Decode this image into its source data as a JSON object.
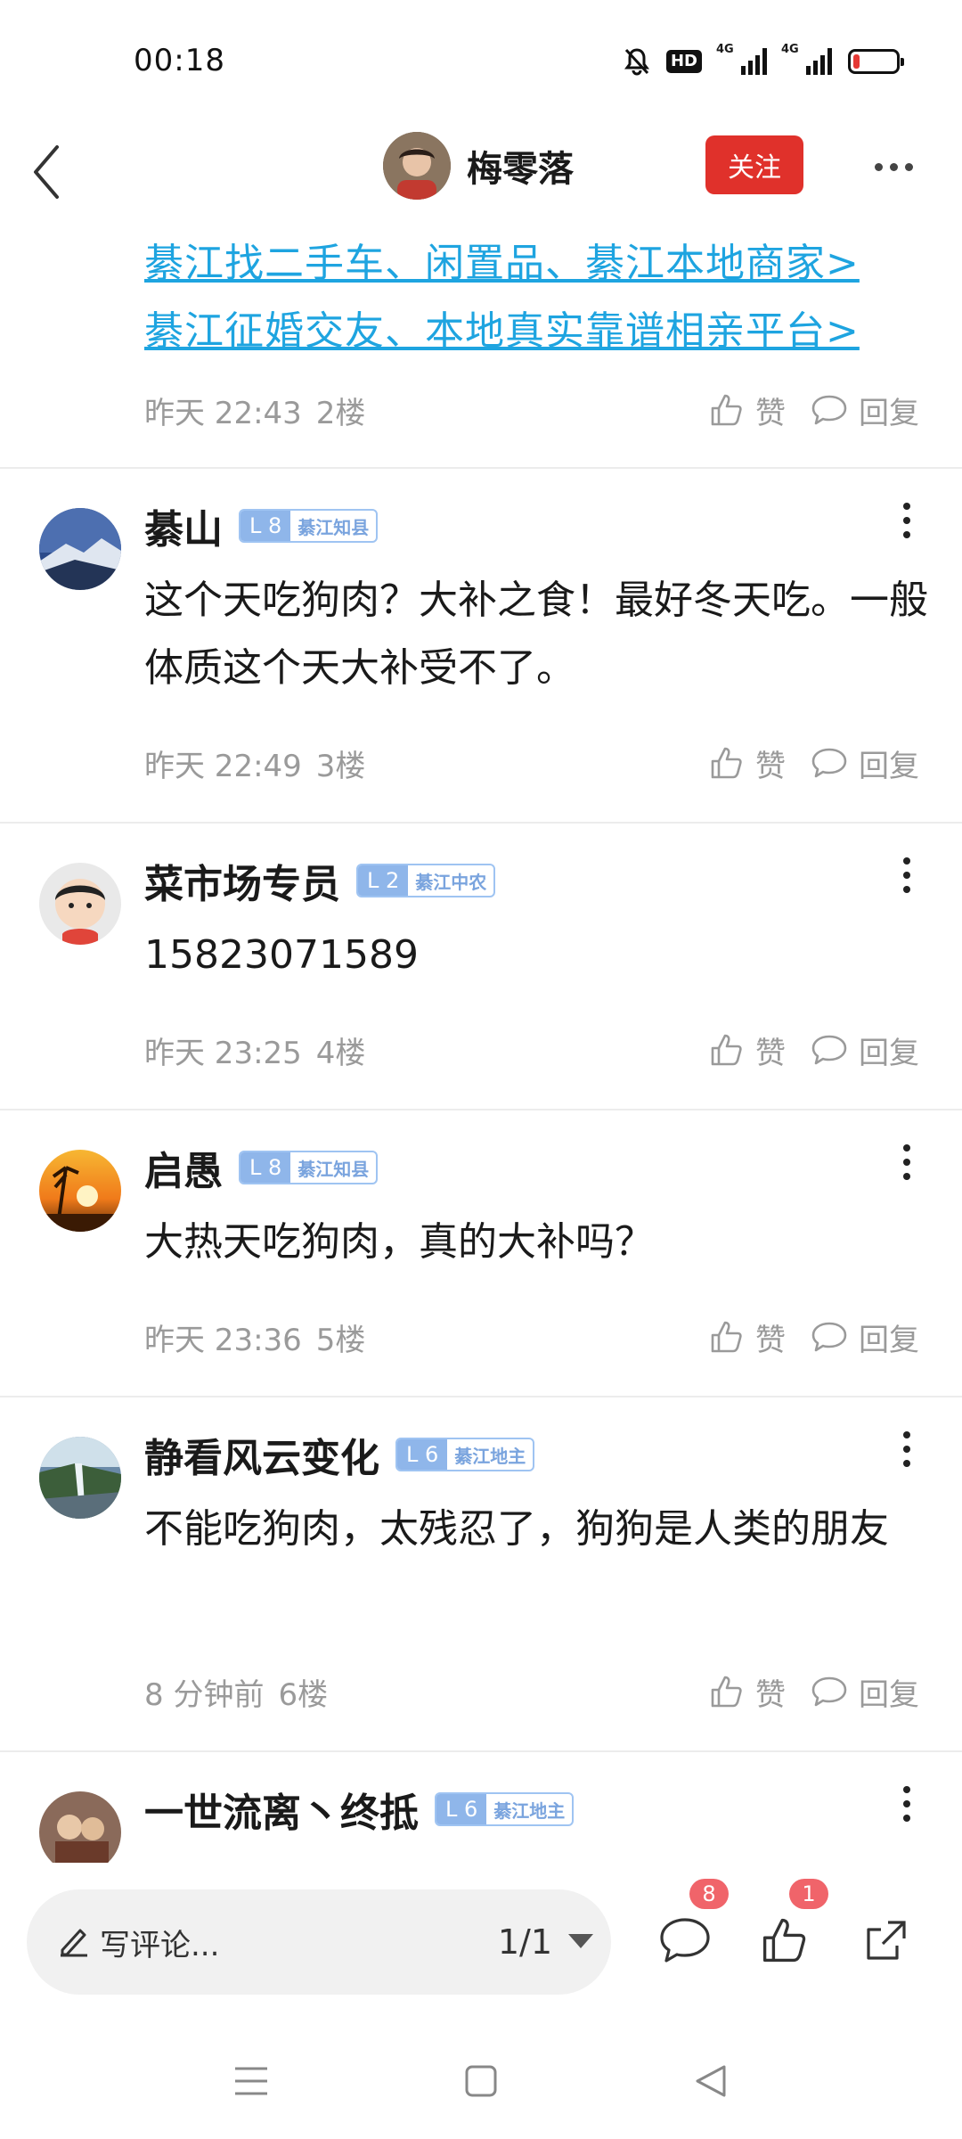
{
  "status_bar": {
    "time": "00:18",
    "hd_label": "HD",
    "net1_label": "4G",
    "net2_label": "4G",
    "battery_level": 0.15,
    "battery_color": "#e53935"
  },
  "header": {
    "author_name": "梅零落",
    "follow_label": "关注"
  },
  "promo_links": [
    "綦江找二手车、闲置品、綦江本地商家>",
    "綦江征婚交友、本地真实靠谱相亲平台>"
  ],
  "floor_2": {
    "time": "昨天 22:43",
    "floor": "2楼",
    "like_label": "赞",
    "reply_label": "回复"
  },
  "comments": [
    {
      "name": "綦山",
      "level": "L 8",
      "level_title": "綦江知县",
      "content": "这个天吃狗肉？大补之食！最好冬天吃。一般体质这个天大补受不了。",
      "time": "昨天 22:49",
      "floor": "3楼",
      "like_label": "赞",
      "reply_label": "回复"
    },
    {
      "name": "菜市场专员",
      "level": "L 2",
      "level_title": "綦江中农",
      "content": "15823071589",
      "time": "昨天 23:25",
      "floor": "4楼",
      "like_label": "赞",
      "reply_label": "回复"
    },
    {
      "name": "启愚",
      "level": "L 8",
      "level_title": "綦江知县",
      "content": "大热天吃狗肉，真的大补吗？",
      "time": "昨天 23:36",
      "floor": "5楼",
      "like_label": "赞",
      "reply_label": "回复"
    },
    {
      "name": "静看风云变化",
      "level": "L 6",
      "level_title": "綦江地主",
      "content": "不能吃狗肉，太残忍了，狗狗是人类的朋友",
      "time": "8 分钟前",
      "floor": "6楼",
      "like_label": "赞",
      "reply_label": "回复"
    },
    {
      "name": "一世流离丶终抵",
      "level": "L 6",
      "level_title": "綦江地主"
    }
  ],
  "bottom_bar": {
    "input_placeholder": "写评论...",
    "page_indicator": "1/1",
    "comment_count": "8",
    "like_count": "1"
  },
  "colors": {
    "accent_red": "#e0312b",
    "link_blue": "#1ea4e0",
    "badge_pink": "#f0646a",
    "level_blue": "#8fb6ea"
  },
  "icons": {
    "back": "chevron-left-icon",
    "more": "more-horizontal-icon",
    "like": "thumbs-up-icon",
    "reply": "speech-bubble-icon",
    "edit": "pencil-icon",
    "share": "share-icon"
  }
}
